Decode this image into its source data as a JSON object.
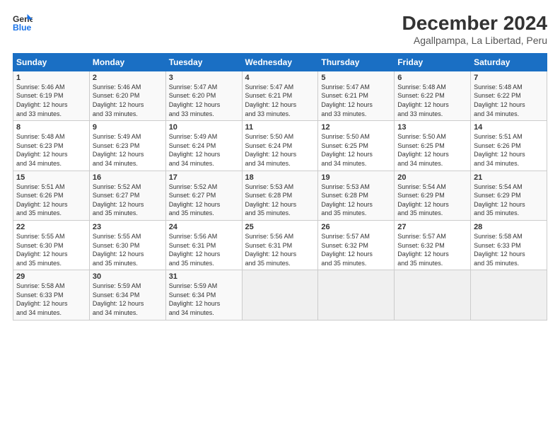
{
  "header": {
    "logo_line1": "General",
    "logo_line2": "Blue",
    "title": "December 2024",
    "subtitle": "Agallpampa, La Libertad, Peru"
  },
  "calendar": {
    "headers": [
      "Sunday",
      "Monday",
      "Tuesday",
      "Wednesday",
      "Thursday",
      "Friday",
      "Saturday"
    ],
    "rows": [
      [
        {
          "day": "1",
          "info": "Sunrise: 5:46 AM\nSunset: 6:19 PM\nDaylight: 12 hours\nand 33 minutes."
        },
        {
          "day": "2",
          "info": "Sunrise: 5:46 AM\nSunset: 6:20 PM\nDaylight: 12 hours\nand 33 minutes."
        },
        {
          "day": "3",
          "info": "Sunrise: 5:47 AM\nSunset: 6:20 PM\nDaylight: 12 hours\nand 33 minutes."
        },
        {
          "day": "4",
          "info": "Sunrise: 5:47 AM\nSunset: 6:21 PM\nDaylight: 12 hours\nand 33 minutes."
        },
        {
          "day": "5",
          "info": "Sunrise: 5:47 AM\nSunset: 6:21 PM\nDaylight: 12 hours\nand 33 minutes."
        },
        {
          "day": "6",
          "info": "Sunrise: 5:48 AM\nSunset: 6:22 PM\nDaylight: 12 hours\nand 33 minutes."
        },
        {
          "day": "7",
          "info": "Sunrise: 5:48 AM\nSunset: 6:22 PM\nDaylight: 12 hours\nand 34 minutes."
        }
      ],
      [
        {
          "day": "8",
          "info": "Sunrise: 5:48 AM\nSunset: 6:23 PM\nDaylight: 12 hours\nand 34 minutes."
        },
        {
          "day": "9",
          "info": "Sunrise: 5:49 AM\nSunset: 6:23 PM\nDaylight: 12 hours\nand 34 minutes."
        },
        {
          "day": "10",
          "info": "Sunrise: 5:49 AM\nSunset: 6:24 PM\nDaylight: 12 hours\nand 34 minutes."
        },
        {
          "day": "11",
          "info": "Sunrise: 5:50 AM\nSunset: 6:24 PM\nDaylight: 12 hours\nand 34 minutes."
        },
        {
          "day": "12",
          "info": "Sunrise: 5:50 AM\nSunset: 6:25 PM\nDaylight: 12 hours\nand 34 minutes."
        },
        {
          "day": "13",
          "info": "Sunrise: 5:50 AM\nSunset: 6:25 PM\nDaylight: 12 hours\nand 34 minutes."
        },
        {
          "day": "14",
          "info": "Sunrise: 5:51 AM\nSunset: 6:26 PM\nDaylight: 12 hours\nand 34 minutes."
        }
      ],
      [
        {
          "day": "15",
          "info": "Sunrise: 5:51 AM\nSunset: 6:26 PM\nDaylight: 12 hours\nand 35 minutes."
        },
        {
          "day": "16",
          "info": "Sunrise: 5:52 AM\nSunset: 6:27 PM\nDaylight: 12 hours\nand 35 minutes."
        },
        {
          "day": "17",
          "info": "Sunrise: 5:52 AM\nSunset: 6:27 PM\nDaylight: 12 hours\nand 35 minutes."
        },
        {
          "day": "18",
          "info": "Sunrise: 5:53 AM\nSunset: 6:28 PM\nDaylight: 12 hours\nand 35 minutes."
        },
        {
          "day": "19",
          "info": "Sunrise: 5:53 AM\nSunset: 6:28 PM\nDaylight: 12 hours\nand 35 minutes."
        },
        {
          "day": "20",
          "info": "Sunrise: 5:54 AM\nSunset: 6:29 PM\nDaylight: 12 hours\nand 35 minutes."
        },
        {
          "day": "21",
          "info": "Sunrise: 5:54 AM\nSunset: 6:29 PM\nDaylight: 12 hours\nand 35 minutes."
        }
      ],
      [
        {
          "day": "22",
          "info": "Sunrise: 5:55 AM\nSunset: 6:30 PM\nDaylight: 12 hours\nand 35 minutes."
        },
        {
          "day": "23",
          "info": "Sunrise: 5:55 AM\nSunset: 6:30 PM\nDaylight: 12 hours\nand 35 minutes."
        },
        {
          "day": "24",
          "info": "Sunrise: 5:56 AM\nSunset: 6:31 PM\nDaylight: 12 hours\nand 35 minutes."
        },
        {
          "day": "25",
          "info": "Sunrise: 5:56 AM\nSunset: 6:31 PM\nDaylight: 12 hours\nand 35 minutes."
        },
        {
          "day": "26",
          "info": "Sunrise: 5:57 AM\nSunset: 6:32 PM\nDaylight: 12 hours\nand 35 minutes."
        },
        {
          "day": "27",
          "info": "Sunrise: 5:57 AM\nSunset: 6:32 PM\nDaylight: 12 hours\nand 35 minutes."
        },
        {
          "day": "28",
          "info": "Sunrise: 5:58 AM\nSunset: 6:33 PM\nDaylight: 12 hours\nand 35 minutes."
        }
      ],
      [
        {
          "day": "29",
          "info": "Sunrise: 5:58 AM\nSunset: 6:33 PM\nDaylight: 12 hours\nand 34 minutes."
        },
        {
          "day": "30",
          "info": "Sunrise: 5:59 AM\nSunset: 6:34 PM\nDaylight: 12 hours\nand 34 minutes."
        },
        {
          "day": "31",
          "info": "Sunrise: 5:59 AM\nSunset: 6:34 PM\nDaylight: 12 hours\nand 34 minutes."
        },
        {
          "day": "",
          "info": ""
        },
        {
          "day": "",
          "info": ""
        },
        {
          "day": "",
          "info": ""
        },
        {
          "day": "",
          "info": ""
        }
      ]
    ]
  }
}
